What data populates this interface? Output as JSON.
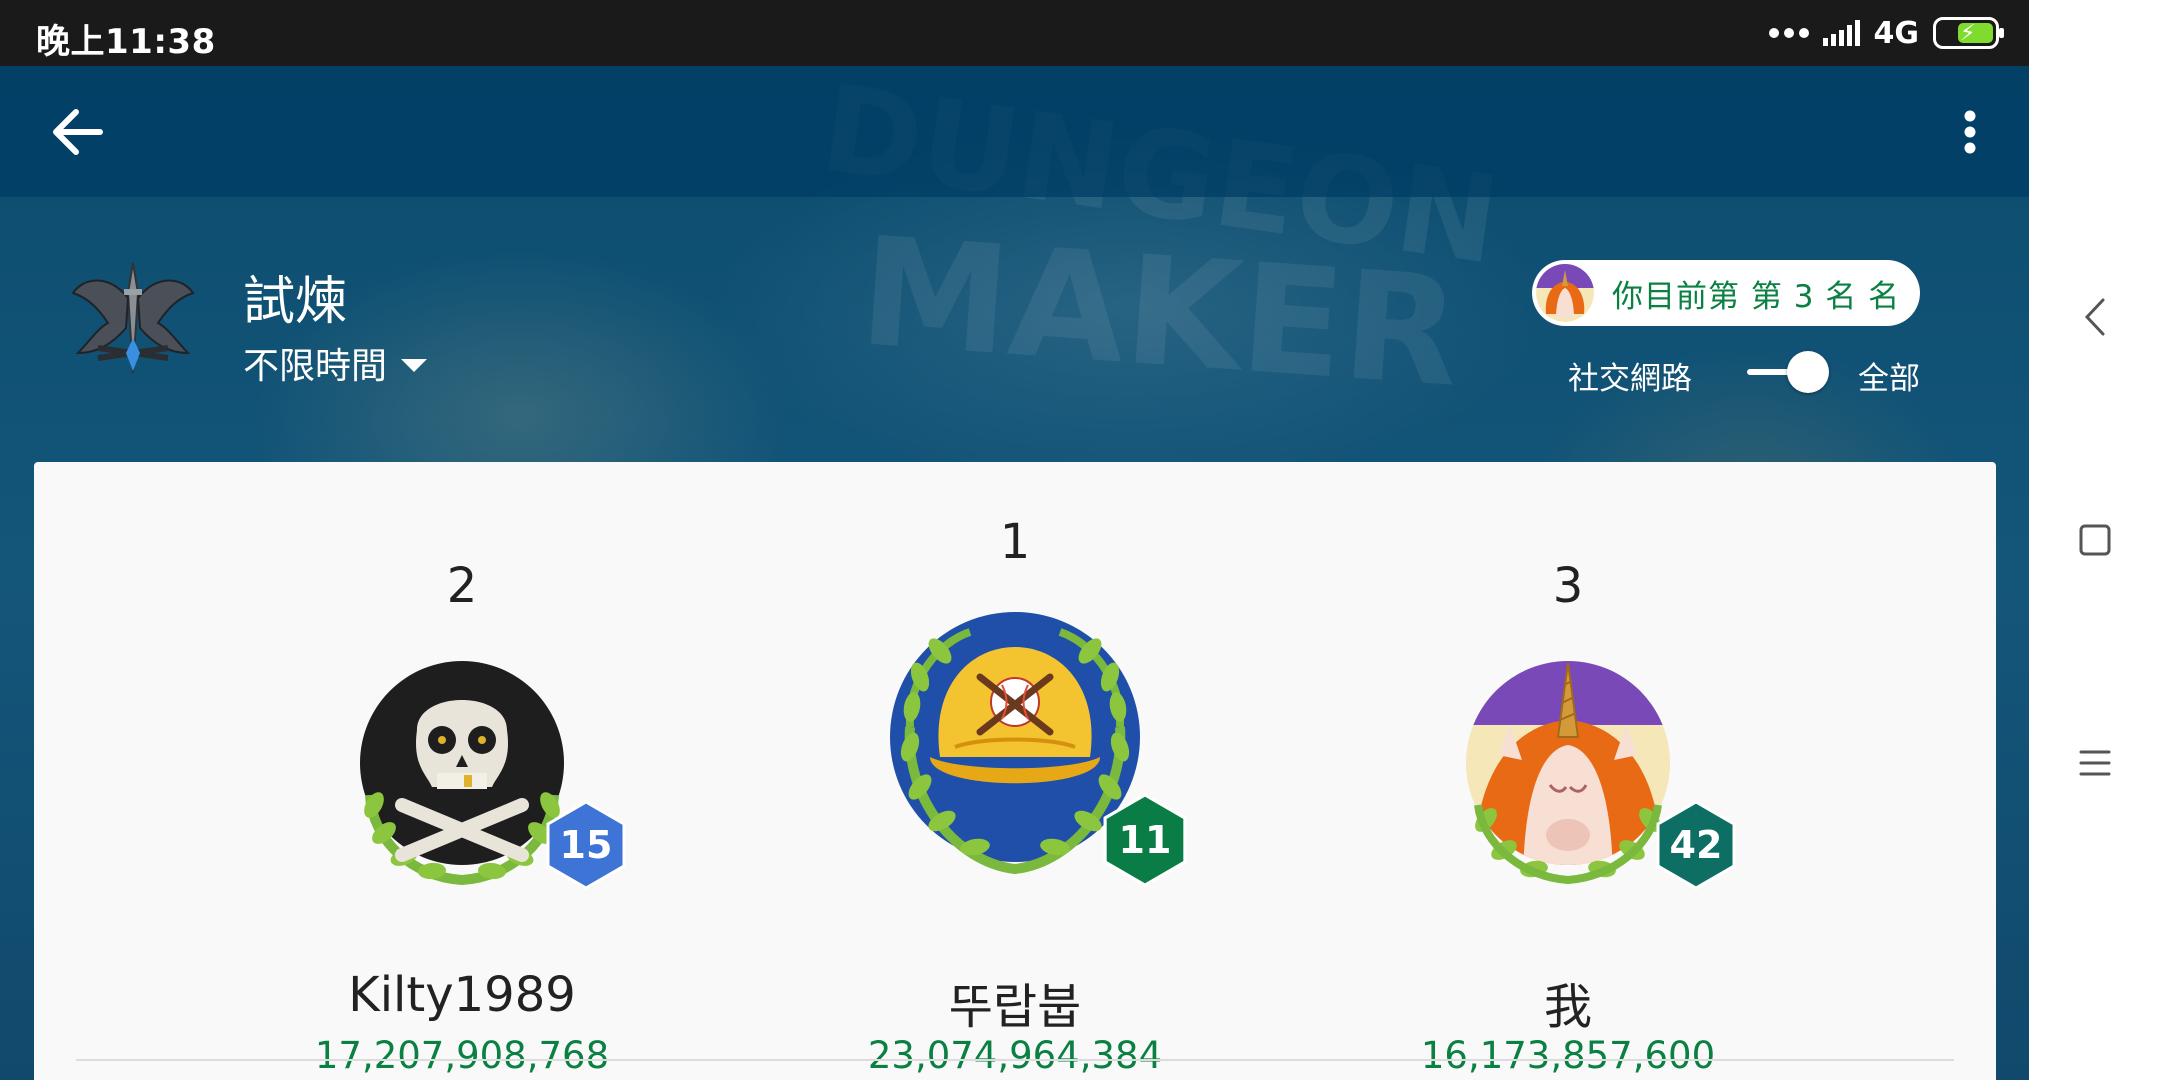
{
  "status_bar": {
    "time": "晚上11:38",
    "network": "4G",
    "icons": [
      "dots-icon",
      "signal-icon",
      "battery-charging-icon"
    ]
  },
  "toolbar": {
    "back_icon": "arrow-left-icon",
    "more_icon": "more-vert-icon"
  },
  "background_art": {
    "logo_lines": [
      "DUNGEON",
      "MAKER"
    ]
  },
  "leaderboard": {
    "title": "試煉",
    "time_filter": "不限時間",
    "my_rank_text": "你目前第 第 3 名 名",
    "scope_left": "社交網路",
    "scope_right": "全部",
    "scope_toggle_on": true
  },
  "podium": {
    "first": {
      "rank": "1",
      "name": "뚜랍붑",
      "score": "23,074,964,384",
      "level": "11",
      "avatar": "baseball-cap-avatar",
      "badge_color": "#0a7d46"
    },
    "second": {
      "rank": "2",
      "name": "Kilty1989",
      "score": "17,207,908,768",
      "level": "15",
      "avatar": "skull-avatar",
      "badge_color": "#3e74d6"
    },
    "third": {
      "rank": "3",
      "name": "我",
      "score": "16,173,857,600",
      "level": "42",
      "avatar": "unicorn-avatar",
      "badge_color": "#0d6e63"
    }
  },
  "colors": {
    "score_green": "#0a8043",
    "app_blue": "#0d4668"
  },
  "nav_bar": {
    "buttons": [
      "nav-back-icon",
      "nav-home-icon",
      "nav-menu-icon"
    ]
  }
}
